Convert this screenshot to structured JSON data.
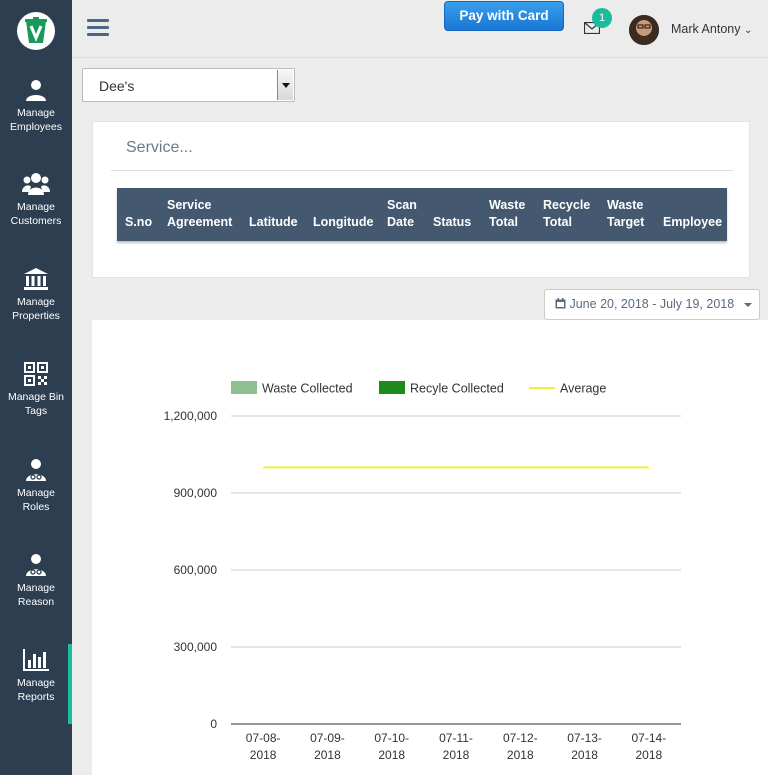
{
  "sidebar": {
    "items": [
      {
        "label_line1": "Manage",
        "label_line2": "Employees",
        "icon": "user-icon"
      },
      {
        "label_line1": "Manage",
        "label_line2": "Customers",
        "icon": "users-icon"
      },
      {
        "label_line1": "Manage",
        "label_line2": "Properties",
        "icon": "building-icon"
      },
      {
        "label_line1": "Manage Bin",
        "label_line2": "Tags",
        "icon": "qrcode-icon"
      },
      {
        "label_line1": "Manage",
        "label_line2": "Roles",
        "icon": "user-md-icon"
      },
      {
        "label_line1": "Manage",
        "label_line2": "Reason",
        "icon": "user-md-icon"
      },
      {
        "label_line1": "Manage",
        "label_line2": "Reports",
        "icon": "bar-chart-icon"
      }
    ]
  },
  "header": {
    "pay_button": "Pay with Card",
    "notification_count": "1",
    "user_name": "Mark Antony"
  },
  "site_select": {
    "selected": "Dee's"
  },
  "panel": {
    "title": "Service...",
    "columns": [
      {
        "l1": "",
        "l2": "S.no"
      },
      {
        "l1": "Service",
        "l2": "Agreement"
      },
      {
        "l1": "",
        "l2": "Latitude"
      },
      {
        "l1": "",
        "l2": "Longitude"
      },
      {
        "l1": "Scan",
        "l2": "Date"
      },
      {
        "l1": "",
        "l2": "Status"
      },
      {
        "l1": "Waste",
        "l2": "Total"
      },
      {
        "l1": "Recycle",
        "l2": "Total"
      },
      {
        "l1": "Waste",
        "l2": "Target"
      },
      {
        "l1": "",
        "l2": "Employee"
      }
    ]
  },
  "date_range": "June 20, 2018 - July 19, 2018",
  "colors": {
    "sidebar_bg": "#2c3e50",
    "accent": "#1abc9c",
    "waste": "#8fbf8f",
    "recycle": "#1e8a1e",
    "average": "#f0f03a"
  },
  "chart_data": {
    "type": "bar",
    "categories": [
      "07-08-2018",
      "07-09-2018",
      "07-10-2018",
      "07-11-2018",
      "07-12-2018",
      "07-13-2018",
      "07-14-2018"
    ],
    "series": [
      {
        "name": "Waste Collected",
        "type": "bar",
        "values": [
          0,
          0,
          0,
          0,
          0,
          0,
          0
        ]
      },
      {
        "name": "Recyle Collected",
        "type": "bar",
        "values": [
          0,
          0,
          0,
          0,
          0,
          0,
          0
        ]
      },
      {
        "name": "Average",
        "type": "line",
        "values": [
          1000000,
          1000000,
          1000000,
          1000000,
          1000000,
          1000000,
          1000000
        ]
      }
    ],
    "ylim": [
      0,
      1200000
    ],
    "yticks": [
      "0",
      "300,000",
      "600,000",
      "900,000",
      "1,200,000"
    ],
    "ytick_values": [
      0,
      300000,
      600000,
      900000,
      1200000
    ],
    "grid": true,
    "legend_position": "top"
  }
}
